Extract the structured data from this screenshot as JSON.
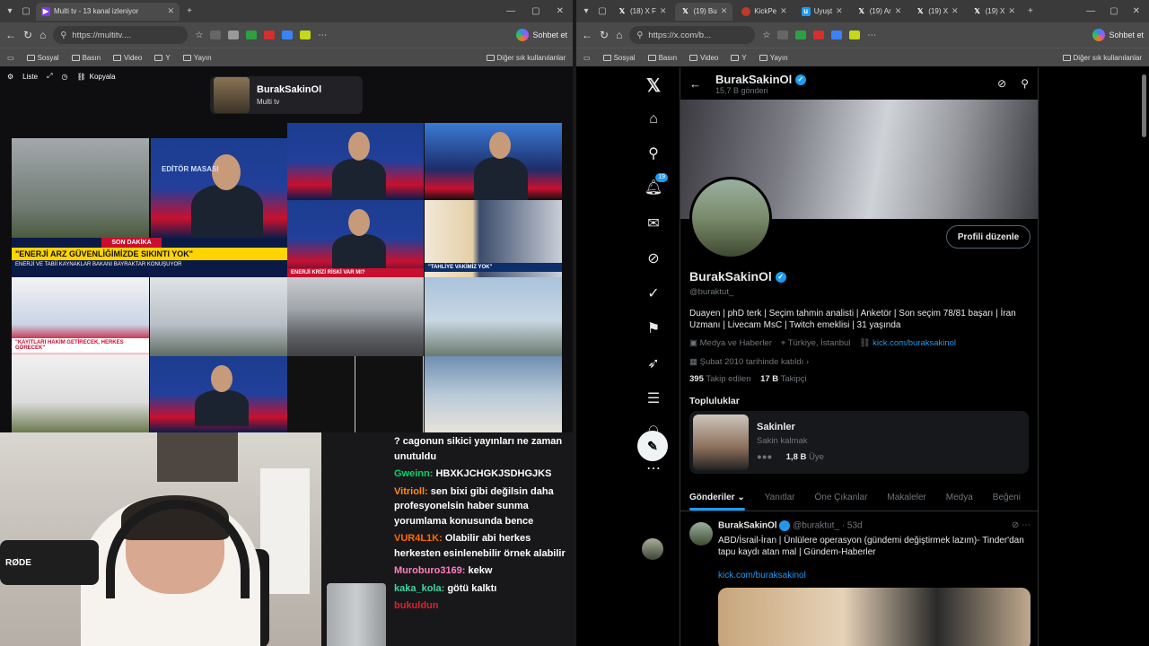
{
  "left": {
    "tab": {
      "title": "Multi tv - 13 kanal izleniyor"
    },
    "url": "https://multitv....",
    "copilot": "Sohbet et",
    "bookmarks": [
      "Sosyal",
      "Basın",
      "Video",
      "Y",
      "Yayın"
    ],
    "bookmarks_right": "Diğer sık kullanılanlar",
    "toolbar": {
      "list": "Liste",
      "copy": "Kopyala"
    },
    "channel": {
      "name": "BurakSakinOl",
      "sub": "Multi tv"
    },
    "tv": {
      "banner1_top": "SON DAKİKA",
      "banner1": "\"ENERJİ ARZ GÜVENLİĞİMİZDE SIKINTI YOK\"",
      "banner1_sub": "ENERJİ VE TABİİ KAYNAKLAR BAKANI BAYRAKTAR KONUŞUYOR",
      "show_label": "EDİTÖR MASASI",
      "ticker2": "ENERJİ KRİZİ RİSKİ VAR MI?",
      "ticker3": "\"TAHLİYE VAKİMİZ YOK\"",
      "ticker4": "\"KAYITLARI HAKİM GETİRECEK, HERKES GÖRECEK\""
    },
    "chat": [
      {
        "user": "",
        "text": "? cagonun sikici yayınları ne zaman unutuldu",
        "color": "#ffffff"
      },
      {
        "user": "Gweinn:",
        "text": "HBXKJCHGKJSDHGJKS",
        "color": "#00d46a"
      },
      {
        "user": "Vitrioll:",
        "text": "sen bixi gibi değilsin daha profesyonelsin haber sunma yorumlama konusunda bence",
        "color": "#ff8c1a"
      },
      {
        "user": "VUR4L1K:",
        "text": "Olabilir abi herkes herkesten esinlenebilir örnek alabilir",
        "color": "#ff6a00"
      },
      {
        "user": "Muroburo3169:",
        "text": "kekw",
        "color": "#ff7fbf"
      },
      {
        "user": "kaka_kola:",
        "text": "götü kalktı",
        "color": "#3fd6a0"
      },
      {
        "user": "bukuldun",
        "text": "",
        "color": "#e0202a"
      }
    ],
    "cam_brand": "RØDE"
  },
  "right": {
    "tabs": [
      "(18) X F",
      "(19) Bu",
      "KickPe",
      "Uyuşt",
      "(19) Ar",
      "(19) X",
      "(19) X"
    ],
    "url": "https://x.com/b...",
    "copilot": "Sohbet et",
    "bookmarks": [
      "Sosyal",
      "Basın",
      "Video",
      "Y",
      "Yayın"
    ],
    "bookmarks_right": "Diğer sık kullanılanlar",
    "profile": {
      "name": "BurakSakinOl",
      "posts": "15,7 B gönderi",
      "handle": "@buraktut_",
      "edit": "Profili düzenle",
      "bio": "Duayen | phD terk | Seçim tahmin analisti | Anketör | Son seçim 78/81 başarı | İran Uzmanı | Livecam MsC | Twitch emeklisi | 31 yaşında",
      "category": "Medya ve Haberler",
      "location": "Türkiye, İstanbul",
      "link": "kick.com/buraksakinol",
      "joined": "Şubat 2010 tarihinde katıldı",
      "following_n": "395",
      "following": "Takip edilen",
      "followers_n": "17 B",
      "followers": "Takipçi"
    },
    "communities": {
      "title": "Topluluklar",
      "name": "Sakinler",
      "sub": "Sakin kalmak",
      "members_n": "1,8 B",
      "members": "Üye"
    },
    "tabs_profile": [
      "Gönderiler",
      "Yanıtlar",
      "Öne Çıkanlar",
      "Makaleler",
      "Medya",
      "Beğeni"
    ],
    "notif_badge": "19",
    "tweet": {
      "name": "BurakSakinOl",
      "handle": "@buraktut_ · 53d",
      "text": "ABD/İsrail-İran | Ünlülere operasyon (gündemi değiştirmek lazım)- Tinder'dan tapu kaydı atan mal | Gündem-Haberler",
      "link": "kick.com/buraksakinol"
    }
  }
}
